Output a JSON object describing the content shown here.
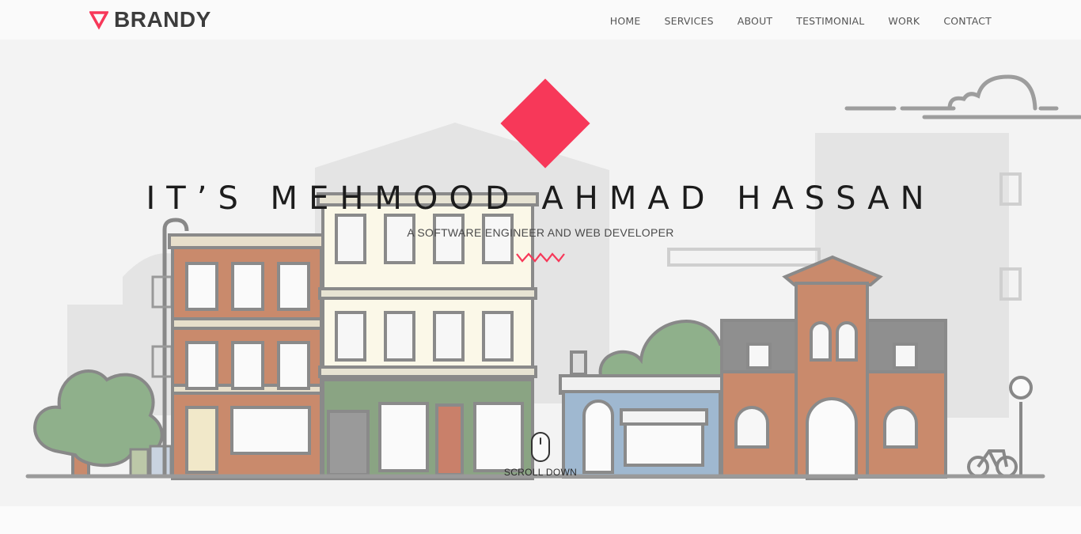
{
  "brand": {
    "name": "BRANDY",
    "logo_icon": "triangle-down-icon",
    "accent": "#f73859"
  },
  "nav": {
    "items": [
      {
        "label": "HOME"
      },
      {
        "label": "SERVICES"
      },
      {
        "label": "ABOUT"
      },
      {
        "label": "TESTIMONIAL"
      },
      {
        "label": "WORK"
      },
      {
        "label": "CONTACT"
      }
    ]
  },
  "hero": {
    "title": "IT’S MEHMOOD AHMAD HASSAN",
    "subtitle": "A SOFTWARE ENGINEER AND WEB DEVELOPER",
    "scroll_label": "SCROLL DOWN",
    "scroll_icon": "mouse-icon",
    "divider_icon": "zigzag-icon",
    "diamond_color": "#f73859"
  }
}
